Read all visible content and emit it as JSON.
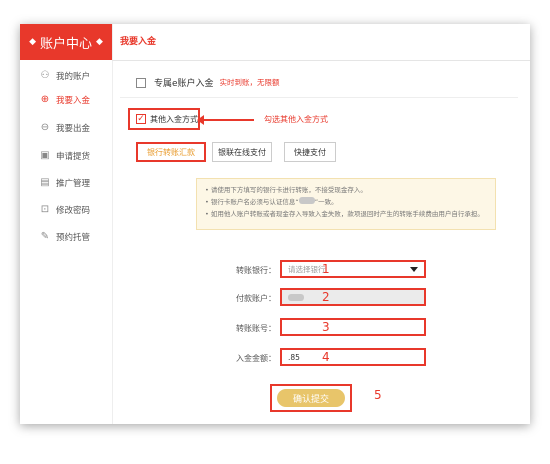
{
  "sidebar": {
    "title": "账户中心",
    "items": [
      {
        "label": "我的账户",
        "icon": "user-icon",
        "glyph": "⚇"
      },
      {
        "label": "我要入金",
        "icon": "deposit-icon",
        "glyph": "⊕"
      },
      {
        "label": "我要出金",
        "icon": "withdraw-icon",
        "glyph": "⊖"
      },
      {
        "label": "申请提货",
        "icon": "truck-icon",
        "glyph": "▣"
      },
      {
        "label": "推广管理",
        "icon": "promote-icon",
        "glyph": "▤"
      },
      {
        "label": "修改密码",
        "icon": "lock-icon",
        "glyph": "⊡"
      },
      {
        "label": "预约托管",
        "icon": "edit-icon",
        "glyph": "✎"
      }
    ]
  },
  "header": {
    "title": "我要入金"
  },
  "exclusive": {
    "label": "专属e账户入金",
    "note": "实时到账，无限额"
  },
  "other_method": {
    "label": "其他入金方式",
    "annotation": "勾选其他入金方式"
  },
  "tabs": [
    "银行转账汇款",
    "银联在线支付",
    "快捷支付"
  ],
  "notice": {
    "line1": "• 请使用下方填写的银行卡进行转账，不接受现金存入。",
    "line2a": "• 银行卡账户名必须与认证信息“",
    "line2b": "”一致。",
    "line3": "• 如用他人账户转账或者现金存入导致入金失败，款项退回时产生的转账手续费由用户自行承担。"
  },
  "form": {
    "bank_label": "转账银行：",
    "bank_placeholder": "请选择银行",
    "payer_label": "付款账户：",
    "account_label": "转账账号：",
    "amount_label": "入金金额：",
    "amount_value": ".85",
    "numbers": [
      "1",
      "2",
      "3",
      "4",
      "5"
    ]
  },
  "submit": {
    "label": "确认提交"
  },
  "colors": {
    "accent": "#e8382b",
    "button": "#e8c56a"
  }
}
